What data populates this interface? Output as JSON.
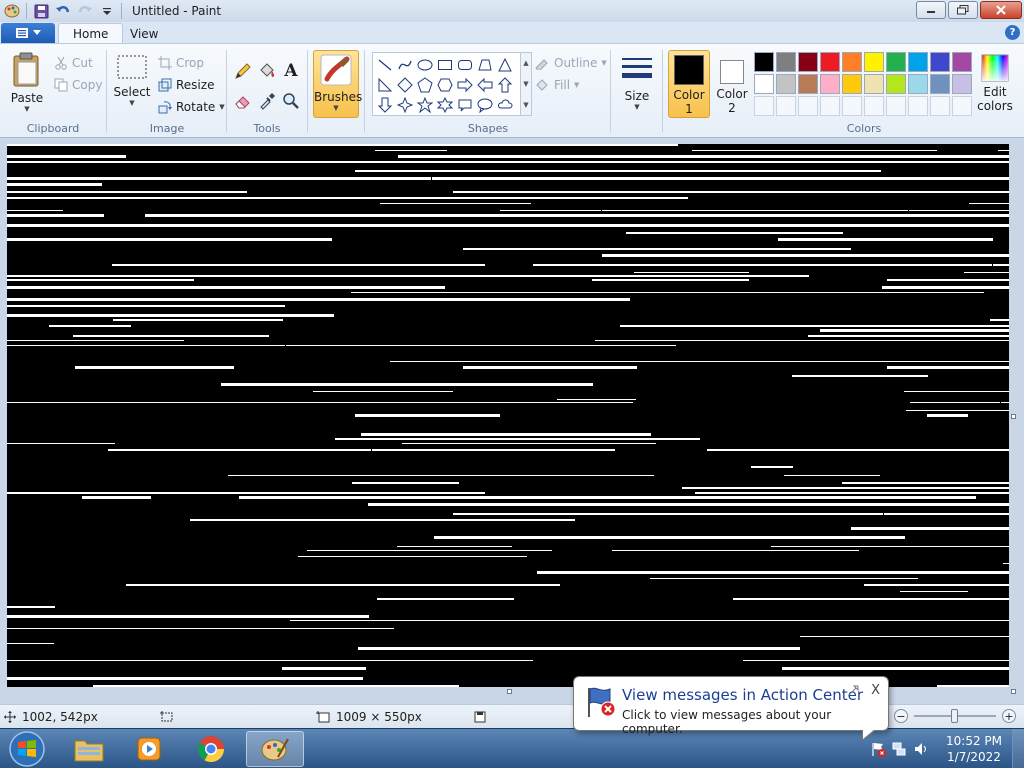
{
  "window": {
    "title": "Untitled - Paint",
    "icon": "paint-palette-icon"
  },
  "quick_access": {
    "save_icon": "save-icon",
    "undo_icon": "undo-icon",
    "redo_icon": "redo-icon",
    "customize_icon": "chevron-down-icon"
  },
  "tabs": {
    "file_icon": "menu-icon",
    "home": "Home",
    "view": "View",
    "help_glyph": "?"
  },
  "clipboard": {
    "label": "Clipboard",
    "paste": "Paste",
    "cut": "Cut",
    "copy": "Copy"
  },
  "image": {
    "label": "Image",
    "select": "Select",
    "crop": "Crop",
    "resize": "Resize",
    "rotate": "Rotate"
  },
  "tools": {
    "label": "Tools",
    "text_glyph": "A"
  },
  "brushes": {
    "label": "Brushes"
  },
  "shapes": {
    "label": "Shapes",
    "outline": "Outline",
    "fill": "Fill"
  },
  "size": {
    "label": "Size"
  },
  "colors": {
    "label": "Colors",
    "color1_line1": "Color",
    "color1_line2": "1",
    "color2_line1": "Color",
    "color2_line2": "2",
    "edit_line1": "Edit",
    "edit_line2": "colors",
    "color1_value": "#000000",
    "color2_value": "#ffffff",
    "palette_row1": [
      "#000000",
      "#7f7f7f",
      "#880015",
      "#ed1c24",
      "#ff7f27",
      "#fff200",
      "#22b14c",
      "#00a2e8",
      "#3f48cc",
      "#a349a4"
    ],
    "palette_row2": [
      "#ffffff",
      "#c3c3c3",
      "#b97a57",
      "#ffaec9",
      "#ffc90e",
      "#efe4b0",
      "#b5e61d",
      "#99d9ea",
      "#7092be",
      "#c8bfe7"
    ]
  },
  "status": {
    "cursor_pos": "1002, 542px",
    "canvas_size": "1009 × 550px"
  },
  "notification": {
    "title": "View messages in Action Center",
    "text": "Click to view messages about your computer.",
    "close_glyph": "X"
  },
  "taskbar": {
    "time": "10:52 PM",
    "date": "1/7/2022"
  }
}
